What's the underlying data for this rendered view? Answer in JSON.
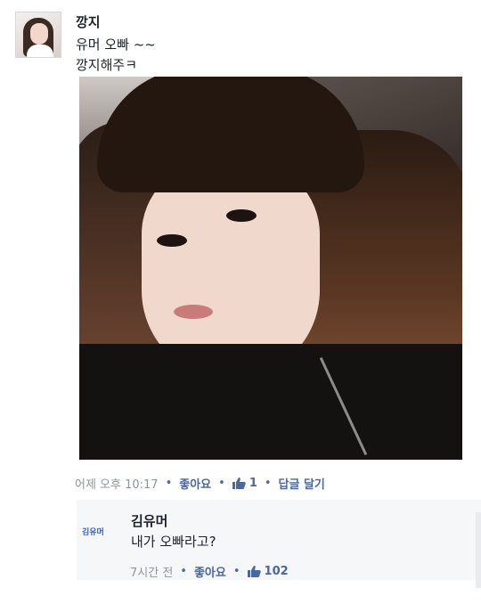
{
  "post": {
    "author": "깡지",
    "lines": [
      "유머 오빠 ~~",
      "깡지해주ㅋ"
    ],
    "meta": {
      "time": "어제 오후 10:17",
      "like_label": "좋아요",
      "like_count": "1",
      "reply_label": "답글 달기"
    }
  },
  "reply": {
    "avatar_text": "김유머",
    "author": "김유머",
    "text": "내가 오빠라고?",
    "meta": {
      "time": "7시간 전",
      "like_label": "좋아요",
      "like_count": "102"
    }
  },
  "colors": {
    "link": "#4b67a1",
    "meta_gray": "#90949c",
    "reply_bg": "#f6f7f9"
  }
}
